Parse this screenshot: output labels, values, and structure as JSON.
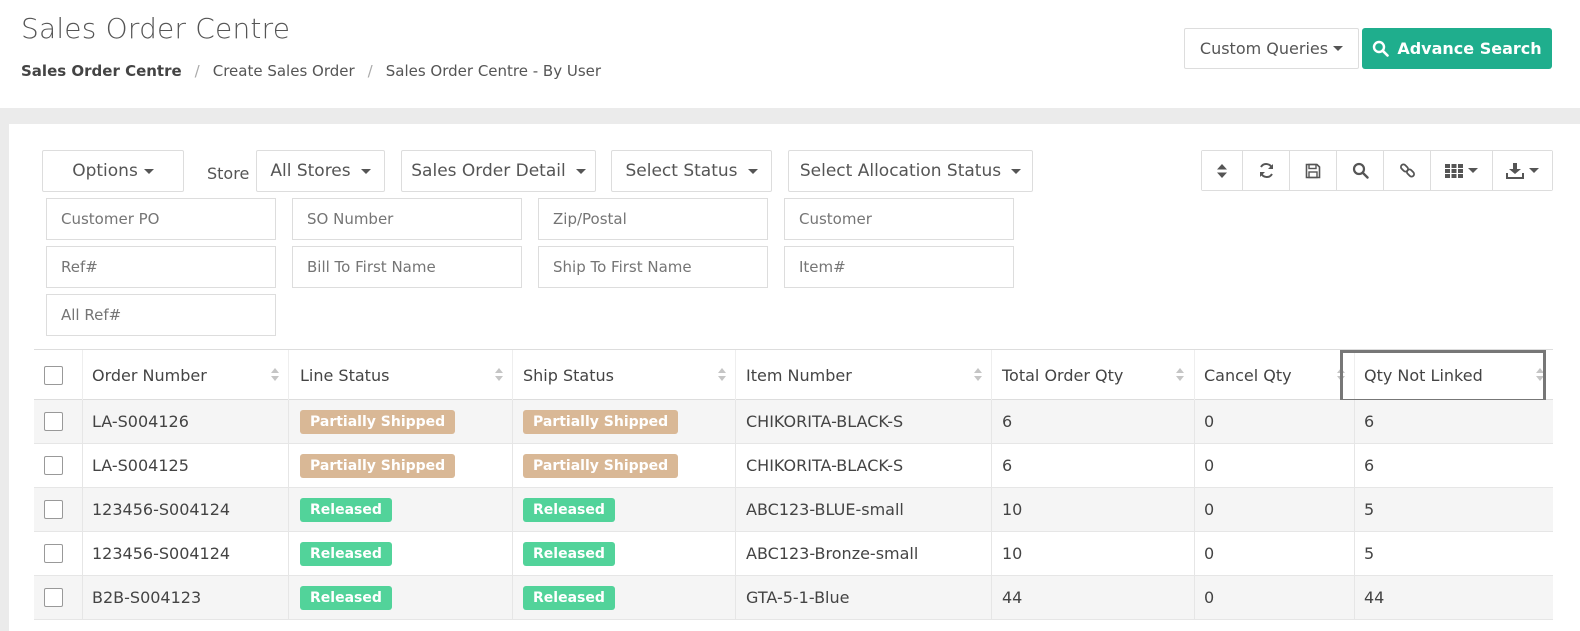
{
  "header": {
    "title": "Sales Order Centre",
    "breadcrumb": [
      "Sales Order Centre",
      "Create Sales Order",
      "Sales Order Centre - By User"
    ],
    "custom_queries_label": "Custom Queries",
    "advance_search_label": "Advance Search"
  },
  "filters": {
    "options_label": "Options",
    "store_label": "Store",
    "store_value": "All Stores",
    "detail_value": "Sales Order Detail",
    "status_value": "Select Status",
    "allocation_value": "Select Allocation Status",
    "placeholders": {
      "customer_po": "Customer PO",
      "so_number": "SO Number",
      "zip": "Zip/Postal",
      "customer": "Customer",
      "ref": "Ref#",
      "bill_to": "Bill To First Name",
      "ship_to": "Ship To First Name",
      "item": "Item#",
      "all_ref": "All Ref#"
    }
  },
  "toolbar": {
    "icons": [
      "sort-icon",
      "refresh-icon",
      "save-icon",
      "search-icon",
      "link-icon",
      "columns-icon",
      "download-icon"
    ]
  },
  "table": {
    "columns": [
      "Order Number",
      "Line Status",
      "Ship Status",
      "Item Number",
      "Total Order Qty",
      "Cancel Qty",
      "Qty Not Linked"
    ],
    "rows": [
      {
        "order": "LA-S004126",
        "line_status": "Partially Shipped",
        "ship_status": "Partially Shipped",
        "item": "CHIKORITA-BLACK-S",
        "total": "6",
        "cancel": "0",
        "not_linked": "6"
      },
      {
        "order": "LA-S004125",
        "line_status": "Partially Shipped",
        "ship_status": "Partially Shipped",
        "item": "CHIKORITA-BLACK-S",
        "total": "6",
        "cancel": "0",
        "not_linked": "6"
      },
      {
        "order": "123456-S004124",
        "line_status": "Released",
        "ship_status": "Released",
        "item": "ABC123-BLUE-small",
        "total": "10",
        "cancel": "0",
        "not_linked": "5"
      },
      {
        "order": "123456-S004124",
        "line_status": "Released",
        "ship_status": "Released",
        "item": "ABC123-Bronze-small",
        "total": "10",
        "cancel": "0",
        "not_linked": "5"
      },
      {
        "order": "B2B-S004123",
        "line_status": "Released",
        "ship_status": "Released",
        "item": "GTA-5-1-Blue",
        "total": "44",
        "cancel": "0",
        "not_linked": "44"
      }
    ]
  },
  "colors": {
    "accent": "#1fae8d",
    "partial_badge": "#d9b896",
    "released_badge": "#52d39a"
  }
}
